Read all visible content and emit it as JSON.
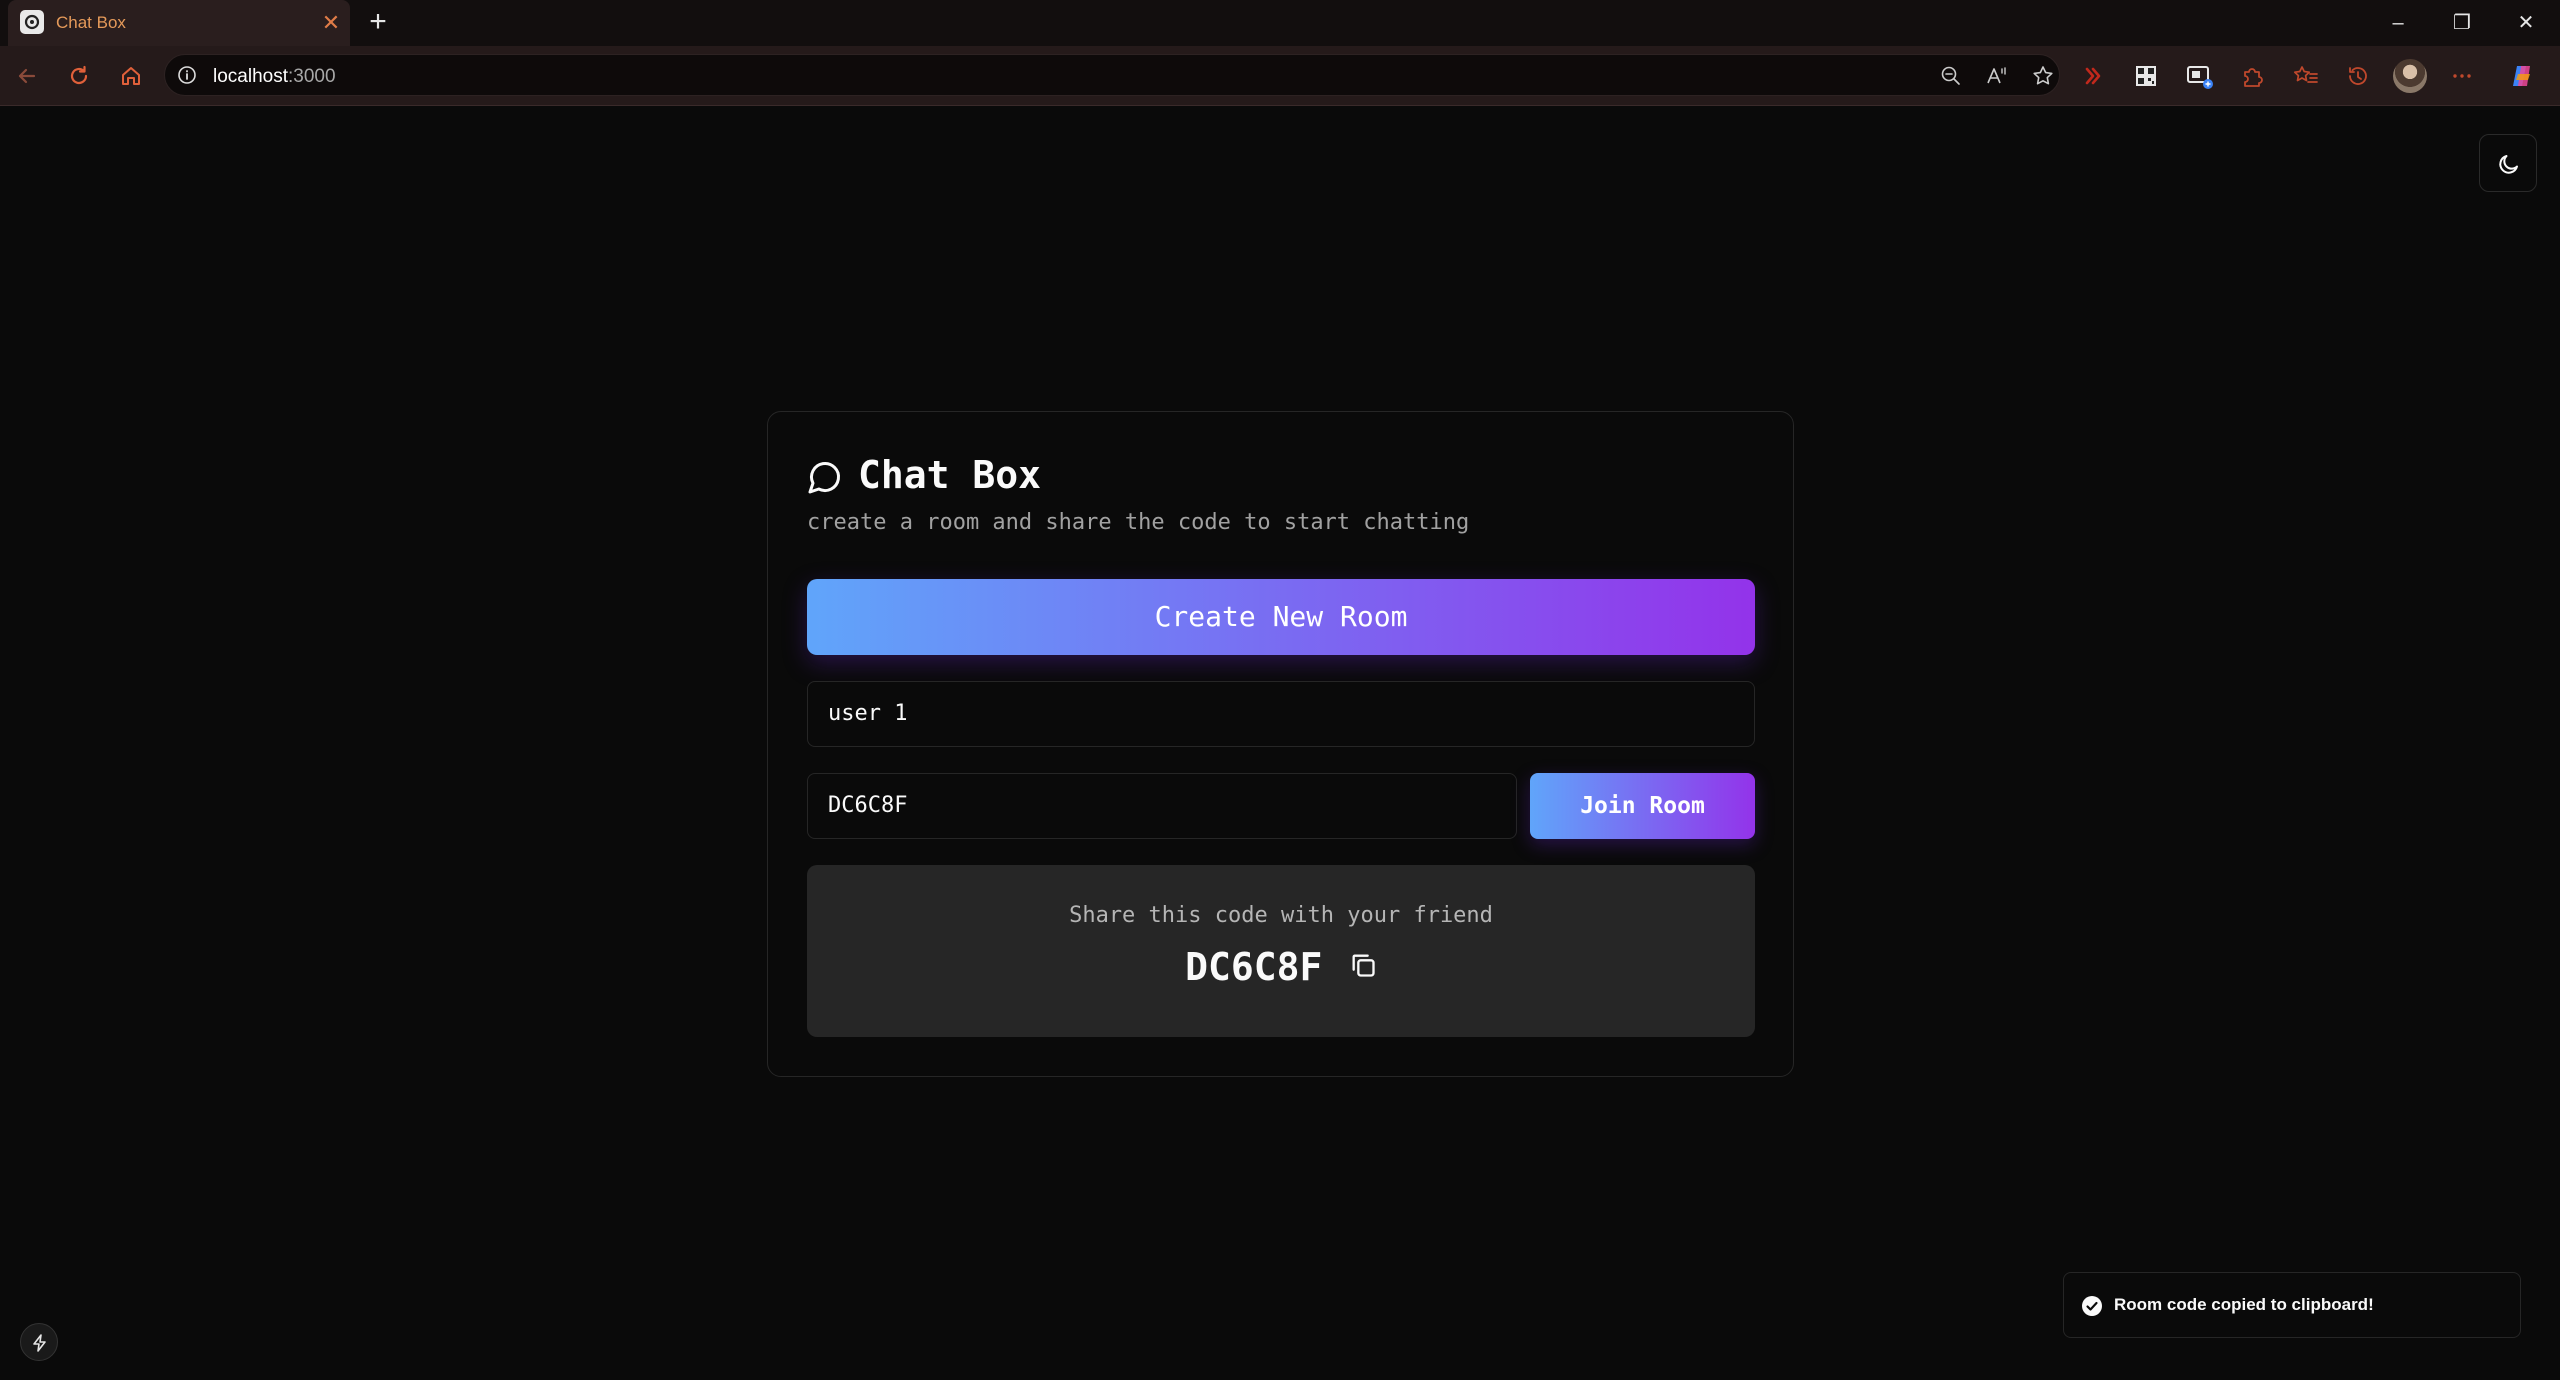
{
  "browser": {
    "tab_title": "Chat Box",
    "url_host": "localhost",
    "url_port": ":3000"
  },
  "card": {
    "title": "Chat Box",
    "subtitle": "create a room and share the code to start chatting",
    "create_button": "Create New Room",
    "name_input_value": "user 1",
    "code_input_value": "DC6C8F",
    "join_button": "Join Room",
    "share_label": "Share this code with your friend",
    "share_code": "DC6C8F"
  },
  "toast": {
    "message": "Room code copied to clipboard!"
  },
  "colors": {
    "accent_from": "#60a5fa",
    "accent_to": "#9333ea",
    "background": "#0a0a0a",
    "share_box": "#262626"
  },
  "icons": [
    "chat-bubble-icon",
    "moon-icon",
    "copy-icon",
    "check-circle-icon",
    "lightning-icon"
  ]
}
